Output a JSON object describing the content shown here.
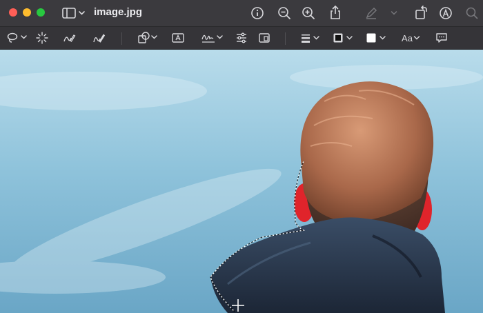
{
  "window": {
    "title": "image.jpg",
    "traffic_lights": {
      "close": "#ff5f57",
      "minimize": "#febc2e",
      "zoom": "#28c840"
    }
  },
  "titlebar_icons": [
    "sidebar-icon",
    "info-icon",
    "zoom-out-icon",
    "zoom-in-icon",
    "share-icon",
    "highlight-pen-icon",
    "rotate-icon",
    "markup-icon",
    "search-icon"
  ],
  "markup_toolbar": {
    "text_style_label": "Aa",
    "tools": [
      "selection-tools",
      "instant-alpha",
      "sketch",
      "draw",
      "shapes",
      "text",
      "sign",
      "adjust-color",
      "adjust-size",
      "shape-style",
      "border-color",
      "fill-color",
      "text-style",
      "image-description"
    ],
    "border_color": "#111111",
    "fill_color": "#ffffff"
  },
  "colors": {
    "accent_chrome": "#3b3a3e",
    "toolbar": "#353438"
  }
}
